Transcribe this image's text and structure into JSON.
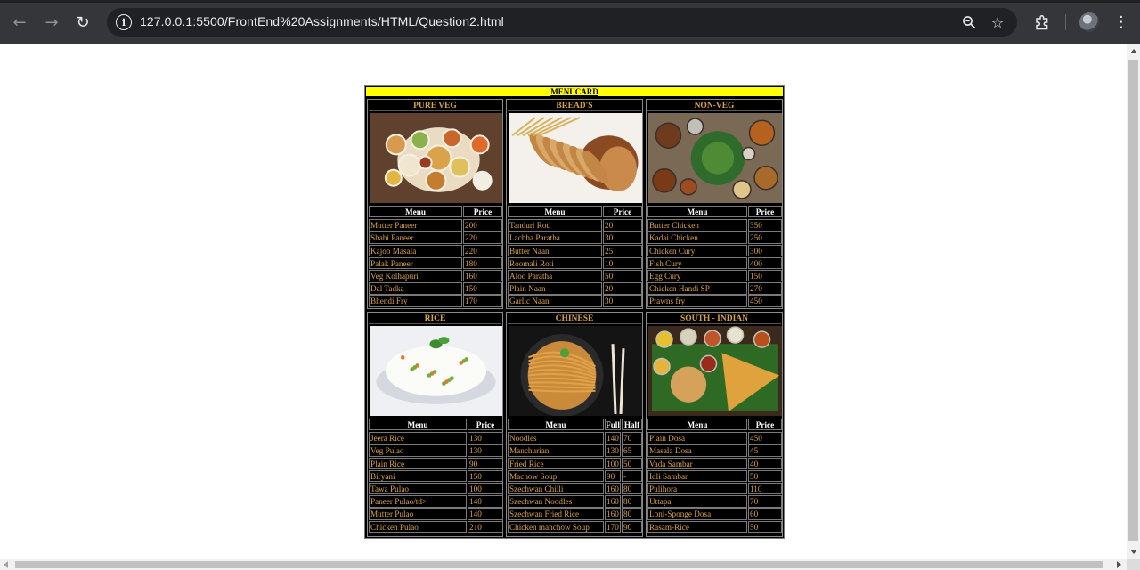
{
  "browser": {
    "url": "127.0.0.1:5500/FrontEnd%20Assignments/HTML/Question2.html",
    "icons": [
      "back-arrow-icon",
      "forward-arrow-icon",
      "reload-icon",
      "site-info-icon",
      "zoom-icon",
      "bookmark-star-icon",
      "extensions-icon",
      "profile-avatar",
      "more-menu-icon"
    ]
  },
  "menucard": {
    "title": "MENUCARD",
    "colors": {
      "title_bg": "#ffff00",
      "text": "#d8a24a",
      "header_text": "#ffffff",
      "bg": "#000000"
    },
    "sections": [
      {
        "title": "PURE VEG",
        "image": "veg-thali-image",
        "headers": [
          "Menu",
          "Price"
        ],
        "rows": [
          [
            "Mutter Paneer",
            "200"
          ],
          [
            "Shahi Paneer",
            "220"
          ],
          [
            "Kajoo Masala",
            "220"
          ],
          [
            "Palak Paneer",
            "180"
          ],
          [
            "Veg Kolhapuri",
            "160"
          ],
          [
            "Dal Tadka",
            "150"
          ],
          [
            "Bhendi Fry",
            "170"
          ]
        ]
      },
      {
        "title": "BREAD'S",
        "image": "breads-image",
        "headers": [
          "Menu",
          "Price"
        ],
        "rows": [
          [
            "Tanduri Roti",
            "20"
          ],
          [
            "Lachha Paratha",
            "30"
          ],
          [
            "Butter Naan",
            "25"
          ],
          [
            "Roomali Roti",
            "10"
          ],
          [
            "Aloo Paratha",
            "50"
          ],
          [
            "Plain Naan",
            "20"
          ],
          [
            "Garlic Naan",
            "30"
          ]
        ]
      },
      {
        "title": "NON-VEG",
        "image": "non-veg-spread-image",
        "headers": [
          "Menu",
          "Price"
        ],
        "rows": [
          [
            "Butter Chicken",
            "350"
          ],
          [
            "Kadai Chicken",
            "250"
          ],
          [
            "Chicken Cury",
            "300"
          ],
          [
            "Fish Cury",
            "400"
          ],
          [
            "Egg Cury",
            "150"
          ],
          [
            "Chicken Handi SP",
            "270"
          ],
          [
            "Prawns fry",
            "450"
          ]
        ]
      },
      {
        "title": "RICE",
        "image": "rice-bowl-image",
        "headers": [
          "Menu",
          "Price"
        ],
        "rows": [
          [
            "Jeera Rice",
            "130"
          ],
          [
            "Veg Pulao",
            "130"
          ],
          [
            "Plain Rice",
            "90"
          ],
          [
            "Biryani",
            "150"
          ],
          [
            "Tawa Pulao",
            "100"
          ],
          [
            "Paneer Pulao/td>",
            "140"
          ],
          [
            "Mutter Pulao",
            "140"
          ],
          [
            "Chicken Pulao",
            "210"
          ]
        ]
      },
      {
        "title": "CHINESE",
        "image": "noodles-image",
        "headers": [
          "Menu",
          "Full",
          "Half"
        ],
        "rows": [
          [
            "Noodles",
            "140",
            "70"
          ],
          [
            "Manchurian",
            "130",
            "65"
          ],
          [
            "Fried Rice",
            "100",
            "50"
          ],
          [
            "Machow Soup",
            "90",
            "-"
          ],
          [
            "Szechwan Chilli",
            "160",
            "80"
          ],
          [
            "Szechwan Noodles",
            "160",
            "80"
          ],
          [
            "Szechwan Fried Rice",
            "160",
            "80"
          ],
          [
            "Chicken manchow Soup",
            "170",
            "90"
          ]
        ]
      },
      {
        "title": "SOUTH - INDIAN",
        "image": "south-indian-platter-image",
        "headers": [
          "Menu",
          "Price"
        ],
        "rows": [
          [
            "Plain Dosa",
            "450"
          ],
          [
            "Masala Dosa",
            "45"
          ],
          [
            "Vada Sambar",
            "40"
          ],
          [
            "Idli Sambar",
            "50"
          ],
          [
            "Pulihora",
            "110"
          ],
          [
            "Uttapa",
            "70"
          ],
          [
            "Loni-Sponge Dosa",
            "60"
          ],
          [
            "Rasam-Rice",
            "50"
          ]
        ]
      }
    ]
  }
}
